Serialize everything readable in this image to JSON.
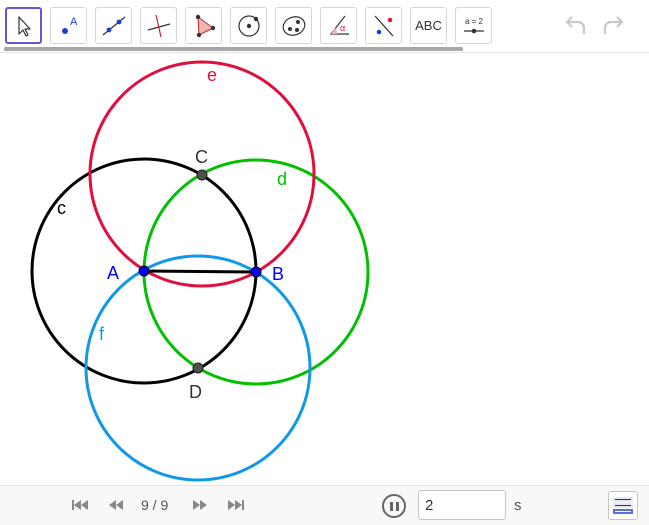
{
  "toolbar": {
    "tools": [
      {
        "icon": "move-arrow-icon",
        "selected": true
      },
      {
        "icon": "point-icon",
        "label": "A"
      },
      {
        "icon": "line-through-two-points-icon"
      },
      {
        "icon": "perpendicular-line-icon"
      },
      {
        "icon": "polygon-icon"
      },
      {
        "icon": "circle-center-point-icon"
      },
      {
        "icon": "conic-through-points-icon"
      },
      {
        "icon": "angle-icon",
        "label": "α"
      },
      {
        "icon": "reflect-about-line-icon"
      },
      {
        "icon": "text-icon",
        "label": "ABC"
      },
      {
        "icon": "slider-icon",
        "label": "a = 2"
      }
    ],
    "undo_icon": "undo-icon",
    "redo_icon": "redo-icon"
  },
  "construction": {
    "points": {
      "A": "A",
      "B": "B",
      "C": "C",
      "D": "D"
    },
    "circles": {
      "c": "c",
      "d": "d",
      "e": "e",
      "f": "f"
    },
    "colors": {
      "c": "#000000",
      "d": "#00c000",
      "e": "#e0103c",
      "f": "#0f99e8",
      "free_point": "#0000ff",
      "dependent_point": "#505050",
      "label_blue": "#0000ff"
    }
  },
  "playbar": {
    "first_icon": "skip-first-icon",
    "prev_icon": "step-back-icon",
    "step_counter": "9 / 9",
    "next_icon": "step-forward-icon",
    "last_icon": "skip-last-icon",
    "pause_icon": "pause-icon",
    "speed_value": "2",
    "speed_unit": "s",
    "algebra_icon": "algebra-view-icon"
  }
}
